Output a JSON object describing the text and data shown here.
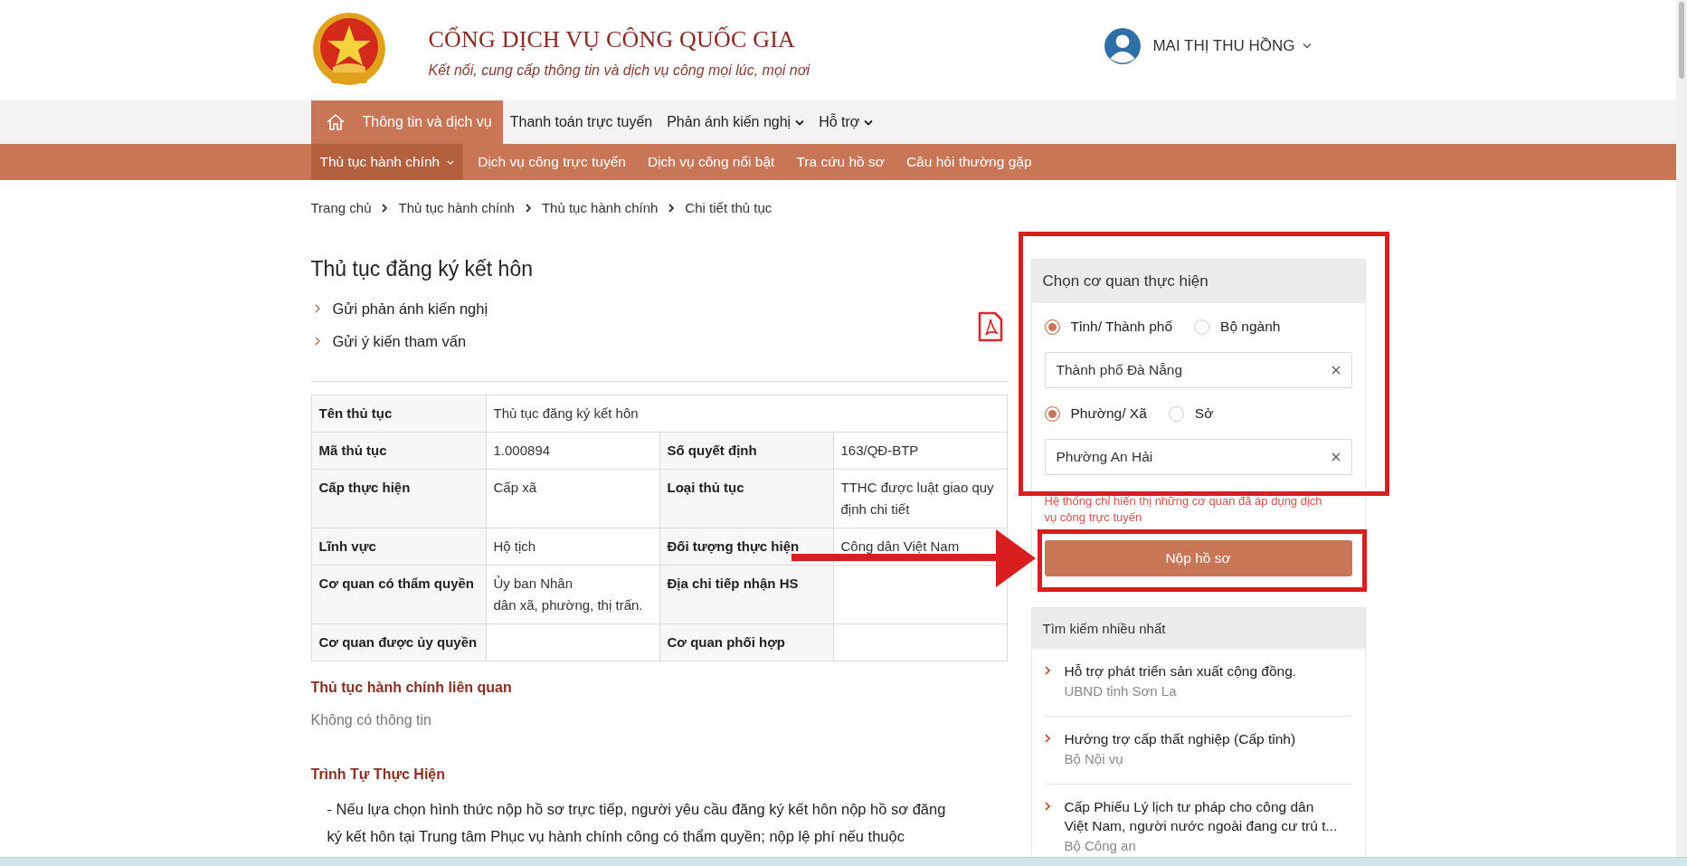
{
  "header": {
    "title": "CỔNG DỊCH VỤ CÔNG QUỐC GIA",
    "tagline": "Kết nối, cung cấp thông tin và dịch vụ công mọi lúc, mọi nơi",
    "user": "MAI THỊ THU HỒNG"
  },
  "main_nav": [
    {
      "label": "Thông tin và dịch vụ",
      "selected": true,
      "dropdown": false
    },
    {
      "label": "Thanh toán trực tuyến",
      "selected": false,
      "dropdown": false
    },
    {
      "label": "Phản ánh kiến nghị",
      "selected": false,
      "dropdown": true
    },
    {
      "label": "Hỗ trợ",
      "selected": false,
      "dropdown": true
    }
  ],
  "sub_nav": [
    {
      "label": "Thủ tục hành chính",
      "selected": true,
      "dropdown": true
    },
    {
      "label": "Dịch vụ công trực tuyến",
      "selected": false,
      "dropdown": false
    },
    {
      "label": "Dịch vụ công nổi bật",
      "selected": false,
      "dropdown": false
    },
    {
      "label": "Tra cứu hồ sơ",
      "selected": false,
      "dropdown": false
    },
    {
      "label": "Câu hỏi thường gặp",
      "selected": false,
      "dropdown": false
    }
  ],
  "breadcrumb": [
    "Trang chủ",
    "Thủ tục hành chính",
    "Thủ tục hành chính",
    "Chi tiết thủ tục"
  ],
  "title": "Thủ tục đăng ký kết hôn",
  "links": [
    "Gửi phản ánh kiến nghị",
    "Gửi ý kiến tham vấn"
  ],
  "table": {
    "rows": [
      [
        {
          "label": "Tên thủ tục",
          "value": "Thủ tục đăng ký kết hôn"
        }
      ],
      [
        {
          "label": "Mã thủ tục",
          "value": "1.000894"
        },
        {
          "label": "Số quyết định",
          "value": "163/QĐ-BTP"
        }
      ],
      [
        {
          "label": "Cấp thực hiện",
          "value": "Cấp xã"
        },
        {
          "label": "Loại thủ tục",
          "value": "TTHC được luật giao quy định chi tiết"
        }
      ],
      [
        {
          "label": "Lĩnh vực",
          "value": "Hộ tịch"
        },
        {
          "label": "Đối tượng thực hiện",
          "value": "Công dân Việt Nam"
        }
      ],
      [
        {
          "label": "Cơ quan có thẩm quyền",
          "value": "Ủy ban Nhân\ndân xã, phường, thị trấn."
        },
        {
          "label": "Địa chỉ tiếp nhận HS"
        }
      ],
      [
        {
          "label": "Cơ quan được ủy quyền"
        },
        {
          "label": "Cơ quan phối hợp"
        }
      ]
    ]
  },
  "sections": [
    {
      "heading": "Thủ tục hành chính liên quan",
      "text": "Không có thông tin",
      "kind": "muted"
    },
    {
      "heading": "Trình Tự Thực Hiện",
      "text": "- Nếu lựa chọn hình thức nộp hồ sơ trực tiếp, người yêu cầu đăng ký kết hôn nộp hồ sơ đăng\nký kết hôn tại Trung tâm Phục vụ hành chính công có thẩm quyền; nộp lệ phí nếu thuộc",
      "kind": "body"
    }
  ],
  "agency_panel": {
    "title": "Chọn cơ quan thực hiện",
    "groups": [
      {
        "options": [
          {
            "label": "Tỉnh/ Thành phố",
            "selected": true
          },
          {
            "label": "Bộ ngành",
            "selected": false
          }
        ],
        "value": "Thành phố Đà Nẵng"
      },
      {
        "options": [
          {
            "label": "Phường/ Xã",
            "selected": true
          },
          {
            "label": "Sở",
            "selected": false
          }
        ],
        "value": "Phường An Hải"
      }
    ],
    "note": "Hệ thống chỉ hiển thị những cơ quan đã áp dụng dịch\nvụ công trực tuyến",
    "button": "Nộp hồ sơ"
  },
  "popular": {
    "title": "Tìm kiếm nhiều nhất",
    "items": [
      {
        "title": "Hỗ trợ phát triển sản xuất cộng đồng.",
        "source": "UBND tỉnh Sơn La"
      },
      {
        "title": "Hưởng trợ cấp thất nghiệp (Cấp tỉnh)",
        "source": "Bộ Nội vụ"
      },
      {
        "title": "Cấp Phiếu Lý lịch tư pháp cho công dân\nViệt Nam, người nước ngoài đang cư trú t...",
        "source": "Bộ Công an"
      }
    ]
  }
}
